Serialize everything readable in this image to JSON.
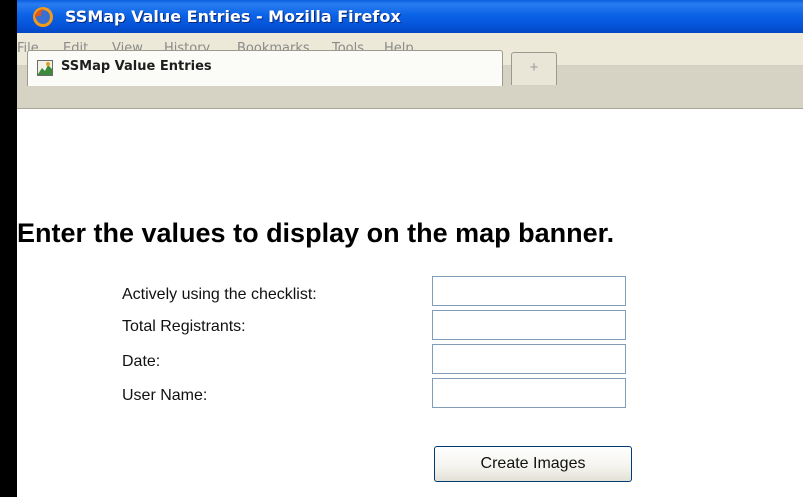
{
  "window": {
    "title": "SSMap Value Entries - Mozilla Firefox"
  },
  "menu": [
    "File",
    "Edit",
    "View",
    "History",
    "Bookmarks",
    "Tools",
    "Help"
  ],
  "tab": {
    "label": "SSMap Value Entries",
    "new_tab_symbol": "+"
  },
  "page": {
    "heading": "Enter the values to display on the map banner.",
    "fields": [
      {
        "label": "Actively using the checklist:",
        "value": ""
      },
      {
        "label": "Total Registrants:",
        "value": ""
      },
      {
        "label": "Date:",
        "value": ""
      },
      {
        "label": "User Name:",
        "value": ""
      }
    ],
    "submit_label": "Create Images"
  }
}
